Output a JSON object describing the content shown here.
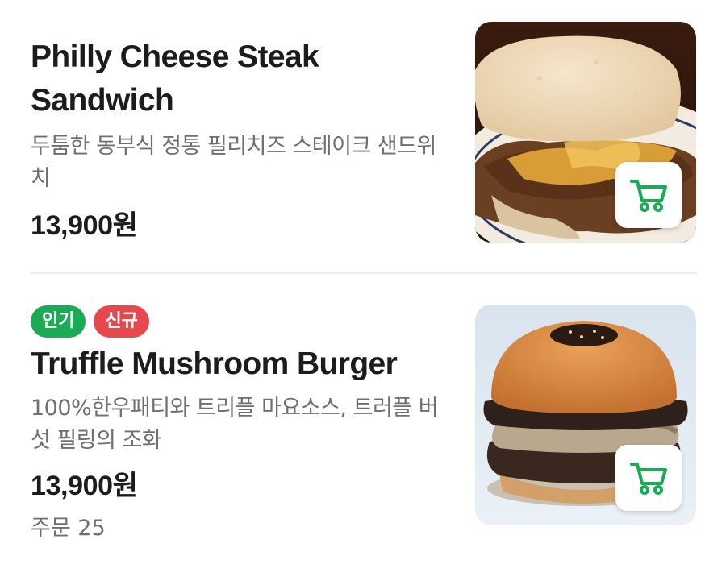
{
  "menu": {
    "items": [
      {
        "name": "Philly Cheese Steak Sandwich",
        "description": "두툼한 동부식 정통 필리치즈 스테이크 샌드위치",
        "price": "13,900원",
        "image": "philly-cheese-steak-sandwich-photo",
        "cart_icon": "cart-icon"
      },
      {
        "badges": [
          "인기",
          "신규"
        ],
        "name": "Truffle Mushroom Burger",
        "description": "100%한우패티와 트리플 마요소스, 트러플 버섯 필링의 조화",
        "price": "13,900원",
        "orders": "주문 25",
        "image": "truffle-mushroom-burger-photo",
        "cart_icon": "cart-icon"
      }
    ]
  },
  "colors": {
    "accent_green": "#1aab54",
    "badge_new_red": "#e5484d",
    "text_primary": "#1c1c1c",
    "text_secondary": "#6f6f6f"
  }
}
